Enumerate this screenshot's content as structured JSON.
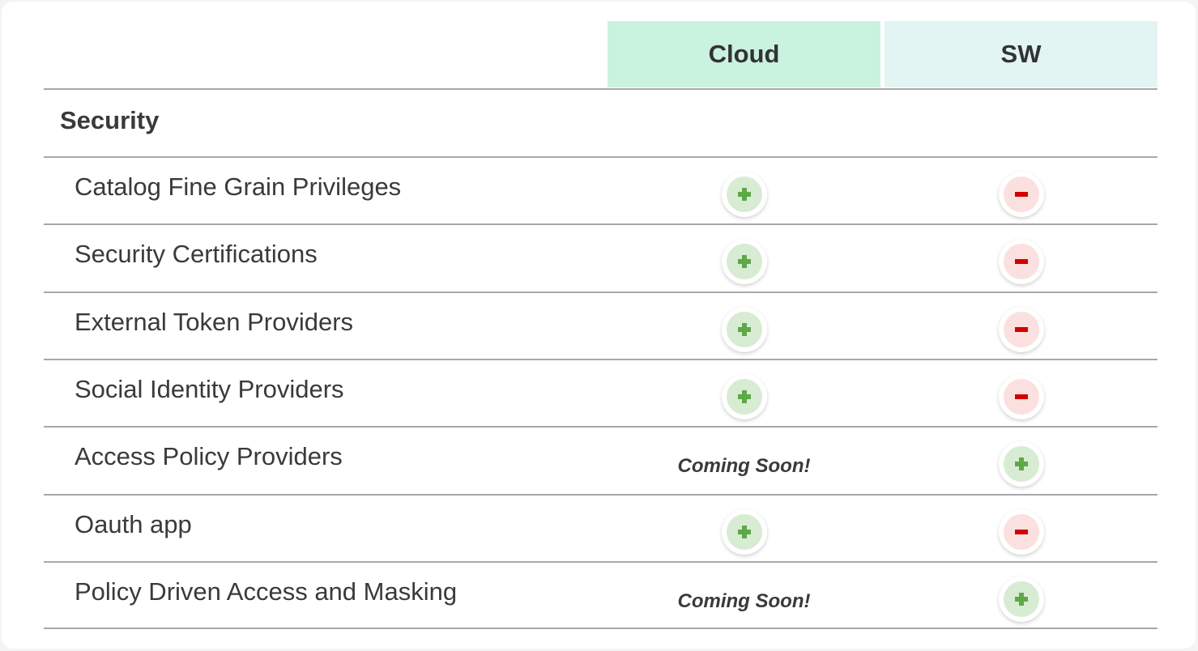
{
  "columns": {
    "cloud": "Cloud",
    "sw": "SW"
  },
  "section": {
    "title": "Security"
  },
  "colors": {
    "cloud_header_bg": "#c9f2df",
    "sw_header_bg": "#e2f5f2",
    "plus_icon": "#5fa84a",
    "minus_icon": "#d40000"
  },
  "rows": [
    {
      "label": "Catalog Fine Grain Privileges",
      "cloud": "plus",
      "sw": "minus"
    },
    {
      "label": "Security Certifications",
      "cloud": "plus",
      "sw": "minus"
    },
    {
      "label": "External Token Providers",
      "cloud": "plus",
      "sw": "minus"
    },
    {
      "label": "Social Identity Providers",
      "cloud": "plus",
      "sw": "minus"
    },
    {
      "label": "Access Policy Providers",
      "cloud": "Coming Soon!",
      "sw": "plus"
    },
    {
      "label": "Oauth app",
      "cloud": "plus",
      "sw": "minus"
    },
    {
      "label": "Policy Driven Access and Masking",
      "cloud": "Coming Soon!",
      "sw": "plus"
    }
  ]
}
